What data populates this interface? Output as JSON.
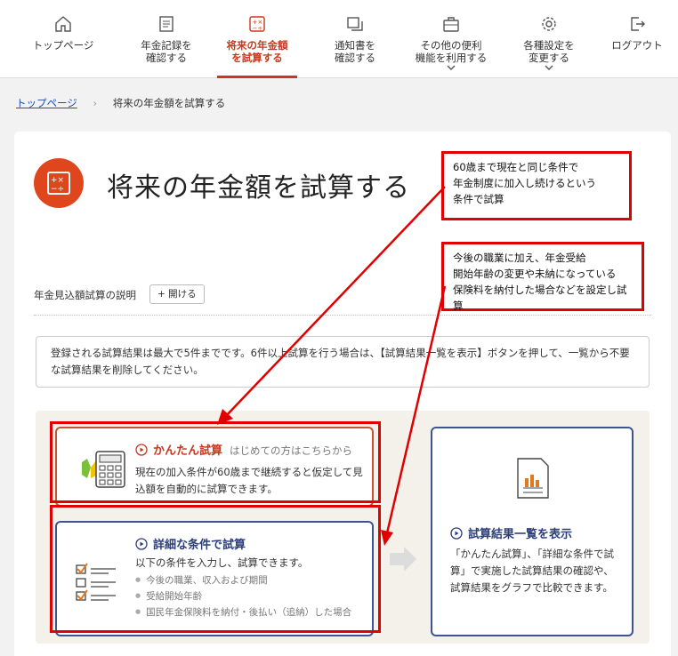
{
  "nav": {
    "items": [
      {
        "label": "トップページ",
        "icon": "home-icon"
      },
      {
        "label": "年金記録を\n確認する",
        "icon": "ledger-icon"
      },
      {
        "label": "将来の年金額\nを試算する",
        "icon": "calculator-icon",
        "active": true
      },
      {
        "label": "通知書を\n確認する",
        "icon": "documents-icon"
      },
      {
        "label": "その他の便利\n機能を利用する",
        "icon": "toolbox-icon",
        "dropdown": true
      },
      {
        "label": "各種設定を\n変更する",
        "icon": "gear-icon",
        "dropdown": true
      },
      {
        "label": "ログアウト",
        "icon": "logout-icon"
      }
    ]
  },
  "breadcrumb": {
    "home": "トップページ",
    "separator": "›",
    "current": "将来の年金額を試算する"
  },
  "page": {
    "title": "将来の年金額を試算する",
    "explanation_label": "年金見込額試算の説明",
    "open_button": "+ 開ける",
    "notice": "登録される試算結果は最大で5件までです。6件以上試算を行う場合は、【試算結果一覧を表示】ボタンを押して、一覧から不要な試算結果を削除してください。"
  },
  "options": {
    "easy": {
      "title": "かんたん試算",
      "subtitle": "はじめての方はこちらから",
      "desc": "現在の加入条件が60歳まで継続すると仮定して見込額を自動的に試算できます。"
    },
    "detailed": {
      "title": "詳細な条件で試算",
      "desc": "以下の条件を入力し、試算できます。",
      "bullets": [
        "今後の職業、収入および期間",
        "受給開始年齢",
        "国民年金保険料を納付・後払い（追納）した場合"
      ]
    },
    "results": {
      "title": "試算結果一覧を表示",
      "desc": "「かんたん試算」、「詳細な条件で試算」で実施した試算結果の確認や、試算結果をグラフで比較できます。"
    }
  },
  "annotations": {
    "note1": "60歳まで現在と同じ条件で\n年金制度に加入し続けるという\n条件で試算",
    "note2": "今後の職業に加え、年金受給\n開始年齢の変更や未納になっている\n保険料を納付した場合などを設定し試算"
  },
  "colors": {
    "accent": "#c8381c",
    "navy": "#3c5490",
    "annotation": "#e00000"
  }
}
